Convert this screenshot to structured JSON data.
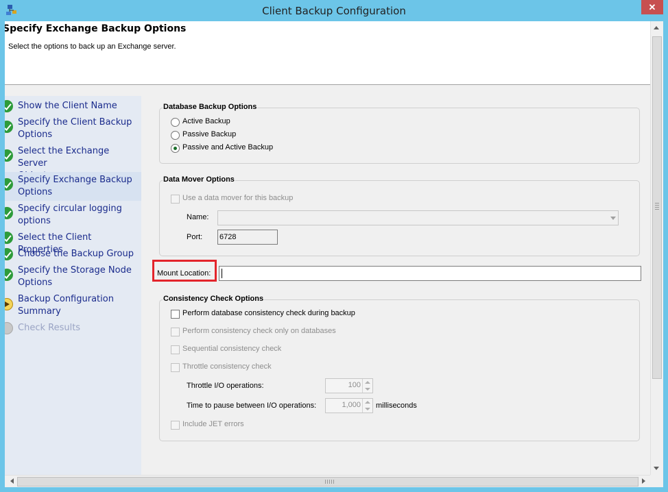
{
  "window": {
    "title": "Client Backup Configuration",
    "close_label": "✕",
    "app_icon": "network-client-icon"
  },
  "header": {
    "title": "Specify Exchange Backup Options",
    "subtitle": "Select the options to back up an Exchange server."
  },
  "nav": {
    "items": [
      {
        "label": "Show the Client Name",
        "status": "done"
      },
      {
        "label": "Specify the Client Backup\nOptions",
        "status": "done"
      },
      {
        "label": "Select the Exchange Server\nObjects",
        "status": "done"
      },
      {
        "label": "Specify Exchange Backup\nOptions",
        "status": "done"
      },
      {
        "label": "Specify circular logging\noptions",
        "status": "done"
      },
      {
        "label": "Select the Client Properties",
        "status": "done"
      },
      {
        "label": "Choose the Backup Group",
        "status": "done"
      },
      {
        "label": "Specify the Storage Node\nOptions",
        "status": "done"
      },
      {
        "label": "Backup Configuration\nSummary",
        "status": "current"
      },
      {
        "label": "Check Results",
        "status": "pending"
      }
    ]
  },
  "database_backup": {
    "title": "Database Backup Options",
    "options": [
      "Active Backup",
      "Passive Backup",
      "Passive and Active Backup"
    ],
    "selected": "Passive and Active Backup"
  },
  "data_mover": {
    "title": "Data Mover Options",
    "use_label": "Use a data mover for this backup",
    "use_checked": false,
    "name_label": "Name:",
    "name_value": "",
    "port_label": "Port:",
    "port_value": "6728"
  },
  "mount": {
    "label": "Mount Location:",
    "value": ""
  },
  "consistency": {
    "title": "Consistency Check Options",
    "perform_label": "Perform database consistency check during backup",
    "perform_only_label": "Perform consistency check only on databases",
    "sequential_label": "Sequential consistency check",
    "throttle_label": "Throttle consistency check",
    "throttle_io_label": "Throttle I/O operations:",
    "throttle_io_value": "100",
    "pause_label": "Time to pause between I/O operations:",
    "pause_value": "1,000",
    "pause_unit": "milliseconds",
    "jet_label": "Include JET errors"
  },
  "colors": {
    "titlebar": "#6cc5e8",
    "close": "#c75050",
    "highlight": "#e3242b",
    "nav_text": "#1a2b8c"
  }
}
